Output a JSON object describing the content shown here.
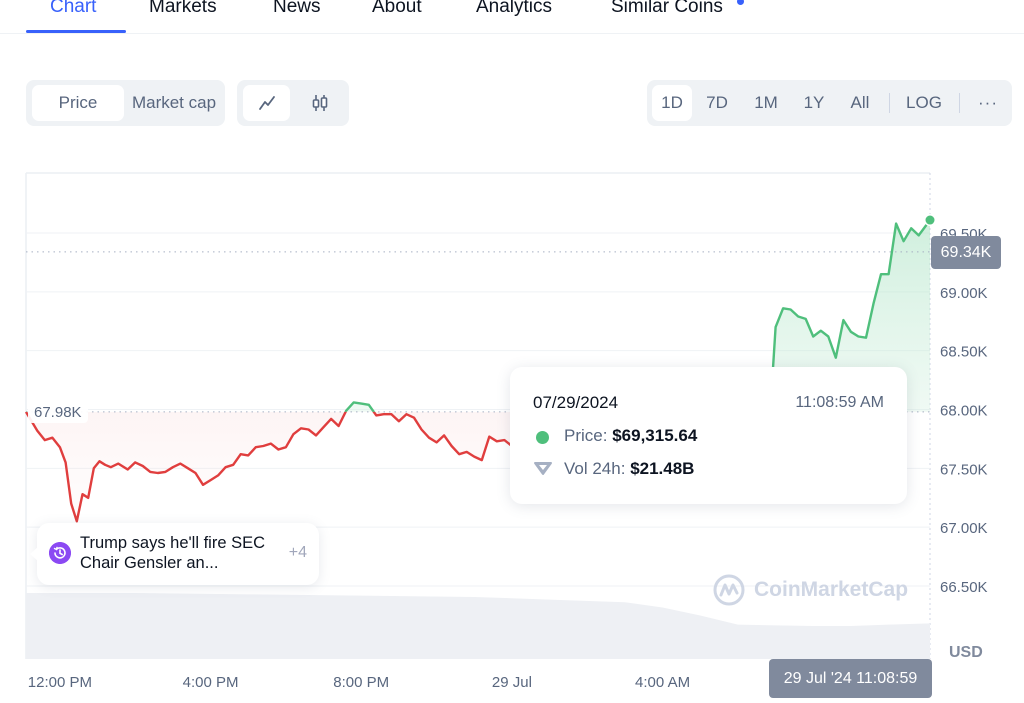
{
  "tabs": [
    {
      "label": "Chart",
      "active": true
    },
    {
      "label": "Markets",
      "active": false
    },
    {
      "label": "News",
      "active": false
    },
    {
      "label": "About",
      "active": false
    },
    {
      "label": "Analytics",
      "active": false
    },
    {
      "label": "Similar Coins",
      "active": false,
      "badge": true
    }
  ],
  "toolbar": {
    "metric_options": [
      {
        "label": "Price",
        "selected": true
      },
      {
        "label": "Market cap",
        "selected": false
      }
    ],
    "chart_types": [
      {
        "icon": "line-chart-icon",
        "selected": true
      },
      {
        "icon": "candlestick-icon",
        "selected": false
      }
    ],
    "ranges": [
      {
        "label": "1D",
        "selected": true
      },
      {
        "label": "7D"
      },
      {
        "label": "1M"
      },
      {
        "label": "1Y"
      },
      {
        "label": "All"
      }
    ],
    "log_label": "LOG",
    "more_label": "···"
  },
  "tooltip": {
    "date": "07/29/2024",
    "time": "11:08:59 AM",
    "price_label": "Price:",
    "price_value": "$69,315.64",
    "vol_label": "Vol 24h:",
    "vol_value": "$21.48B"
  },
  "news": {
    "text": "Trump says he'll fire SEC Chair Gensler an...",
    "more": "+4"
  },
  "labels": {
    "baseline": "67.98K",
    "current_price": "69.34K",
    "crosshair_time": "29 Jul '24 11:08:59",
    "currency": "USD",
    "watermark": "CoinMarketCap"
  },
  "colors": {
    "accent": "#3861fb",
    "up": "#4fbf7c",
    "down": "#e03e3e",
    "axis_text": "#58667e",
    "label_bg": "#808a9d"
  },
  "chart_data": {
    "type": "area",
    "title": "",
    "xlabel": "",
    "ylabel": "USD",
    "baseline": 67980,
    "current": 69340,
    "ylim": [
      66200,
      69900
    ],
    "yticks": [
      66500,
      67000,
      67500,
      68000,
      68500,
      69000,
      69500
    ],
    "ytick_labels": [
      "66.50K",
      "67.00K",
      "67.50K",
      "68.00K",
      "68.50K",
      "69.00K",
      "69.50K"
    ],
    "xlim_hours": [
      -0.9,
      23.1
    ],
    "xticks_hours": [
      0,
      4,
      8,
      12,
      16
    ],
    "xtick_labels": [
      "12:00 PM",
      "4:00 PM",
      "8:00 PM",
      "29 Jul",
      "4:00 AM"
    ],
    "grid": true,
    "series": [
      {
        "name": "Price",
        "x_hours": [
          -0.9,
          -0.6,
          -0.4,
          -0.2,
          0.0,
          0.15,
          0.3,
          0.45,
          0.6,
          0.75,
          0.9,
          1.05,
          1.2,
          1.35,
          1.55,
          1.8,
          2.0,
          2.2,
          2.4,
          2.6,
          2.8,
          3.0,
          3.2,
          3.4,
          3.6,
          3.8,
          4.0,
          4.2,
          4.4,
          4.6,
          4.8,
          5.0,
          5.2,
          5.4,
          5.6,
          5.8,
          6.0,
          6.2,
          6.4,
          6.6,
          6.8,
          7.0,
          7.2,
          7.4,
          7.6,
          7.8,
          8.0,
          8.2,
          8.4,
          8.6,
          8.8,
          9.0,
          9.2,
          9.4,
          9.6,
          9.8,
          10.0,
          10.2,
          10.4,
          10.6,
          10.8,
          11.0,
          11.2,
          11.4,
          11.6,
          11.8,
          12.0,
          12.2,
          12.4,
          12.6,
          12.8,
          13.0,
          13.2,
          13.4,
          13.6,
          13.8,
          14.0,
          14.2,
          14.4,
          14.6,
          14.8,
          15.0,
          15.2,
          15.4,
          15.6,
          15.8,
          16.0,
          16.2,
          16.4,
          16.6,
          16.8,
          17.0,
          17.2,
          17.4,
          17.6,
          17.8,
          18.0,
          18.2,
          18.4,
          18.6,
          18.8,
          19.0,
          19.2,
          19.4,
          19.6,
          19.8,
          20.0,
          20.2,
          20.4,
          20.6,
          20.8,
          21.0,
          21.2,
          21.4,
          21.6,
          21.8,
          22.0,
          22.2,
          22.4,
          22.6,
          22.8,
          23.1
        ],
        "values": [
          67980,
          67820,
          67740,
          67760,
          67680,
          67550,
          67200,
          67050,
          67280,
          67250,
          67500,
          67560,
          67530,
          67510,
          67540,
          67490,
          67550,
          67520,
          67470,
          67460,
          67470,
          67510,
          67540,
          67500,
          67460,
          67360,
          67400,
          67440,
          67510,
          67530,
          67620,
          67610,
          67680,
          67690,
          67710,
          67660,
          67680,
          67790,
          67840,
          67830,
          67780,
          67850,
          67920,
          67860,
          67990,
          68060,
          68050,
          68040,
          67950,
          67960,
          67960,
          67900,
          67960,
          67930,
          67830,
          67760,
          67720,
          67780,
          67690,
          67620,
          67640,
          67600,
          67570,
          67770,
          67730,
          67740,
          67690,
          67690,
          67620,
          67680,
          67630,
          67650,
          67730,
          67680,
          67730,
          67700,
          67720,
          67700,
          67760,
          67730,
          67760,
          67680,
          67660,
          67700,
          67640,
          67640,
          67600,
          67620,
          67560,
          67580,
          67560,
          67540,
          67570,
          67550,
          67560,
          67560,
          67530,
          67560,
          67550,
          67540,
          67680,
          68700,
          68860,
          68850,
          68790,
          68770,
          68620,
          68670,
          68620,
          68440,
          68760,
          68660,
          68620,
          68610,
          68900,
          69150,
          69150,
          69580,
          69430,
          69540,
          69480,
          69610,
          69470,
          69420,
          69380,
          69340
        ]
      },
      {
        "name": "Volume",
        "relative_heights_note": "background volume area, high early and declining later",
        "x_hours": [
          -0.9,
          2,
          5,
          8,
          11,
          13,
          15,
          16,
          17,
          18,
          20,
          21,
          22,
          23.1
        ],
        "values": [
          1.0,
          1.0,
          0.98,
          0.96,
          0.94,
          0.9,
          0.86,
          0.78,
          0.66,
          0.52,
          0.5,
          0.5,
          0.52,
          0.54
        ]
      }
    ]
  }
}
